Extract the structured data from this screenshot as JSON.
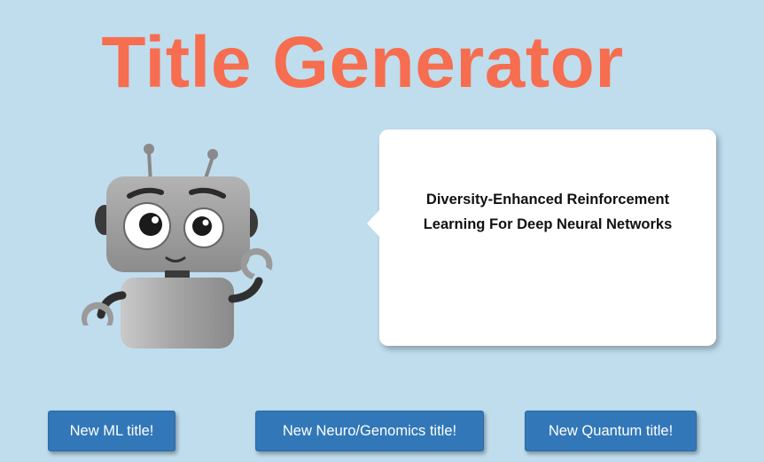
{
  "header": {
    "title": "Title Generator"
  },
  "bubble": {
    "text": "Diversity-Enhanced Reinforcement Learning For Deep Neural Networks"
  },
  "buttons": {
    "ml_label": "New ML title!",
    "neuro_label": "New Neuro/Genomics title!",
    "quantum_label": "New Quantum title!"
  },
  "icons": {
    "robot": "robot-illustration"
  },
  "colors": {
    "background": "#c0ddee",
    "title": "#f76d4f",
    "button": "#3277b8",
    "bubble": "#ffffff"
  }
}
